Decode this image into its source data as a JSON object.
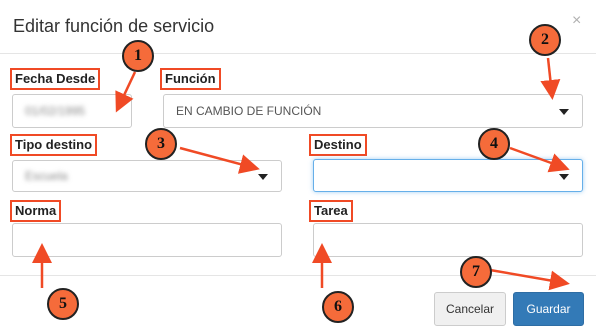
{
  "dialog": {
    "title": "Editar función de servicio",
    "close_glyph": "×"
  },
  "form": {
    "fecha_desde": {
      "label": "Fecha Desde",
      "value": "01/02/1995"
    },
    "funcion": {
      "label": "Función",
      "value": "EN CAMBIO DE FUNCIÓN"
    },
    "tipo_destino": {
      "label": "Tipo destino",
      "value": "Escuela"
    },
    "destino": {
      "label": "Destino",
      "value": ""
    },
    "norma": {
      "label": "Norma",
      "value": ""
    },
    "tarea": {
      "label": "Tarea",
      "value": ""
    }
  },
  "footer": {
    "cancel_label": "Cancelar",
    "save_label": "Guardar"
  },
  "annotations": [
    "1",
    "2",
    "3",
    "4",
    "5",
    "6",
    "7"
  ],
  "colors": {
    "annotation": "#f04a25",
    "primary_button": "#337ab7",
    "focus_border": "#66afe9"
  }
}
